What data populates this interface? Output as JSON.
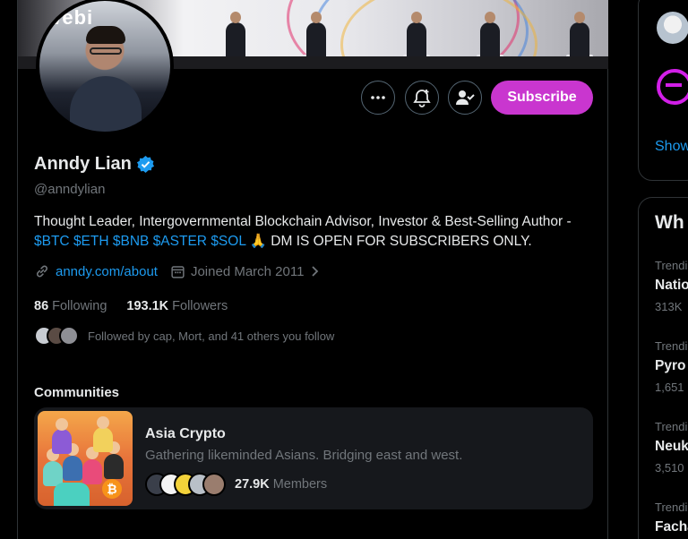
{
  "profile": {
    "name": "Anndy Lian",
    "handle": "@anndylian",
    "bio_text": "Thought Leader, Intergovernmental Blockchain Advisor, Investor & Best-Selling Author - ",
    "bio_tags": [
      "$BTC",
      "$ETH",
      "$BNB",
      "$ASTER",
      "$SOL"
    ],
    "bio_emoji": "🙏",
    "bio_tail": " DM IS OPEN FOR SUBSCRIBERS ONLY.",
    "website": "anndy.com/about",
    "joined": "Joined March 2011",
    "following_count": "86",
    "following_label": "Following",
    "followers_count": "193.1K",
    "followers_label": "Followers",
    "followed_by": "Followed by cap, Mort, and 41 others you follow",
    "avatar_banner_text": "Webi"
  },
  "actions": {
    "more_icon": "more-horizontal-icon",
    "notify_icon": "bell-plus-icon",
    "following_icon": "person-check-icon",
    "subscribe_label": "Subscribe"
  },
  "communities": {
    "title": "Communities",
    "items": [
      {
        "name": "Asia Crypto",
        "description": "Gathering likeminded Asians. Bridging east and west.",
        "members_count": "27.9K",
        "members_label": "Members"
      }
    ]
  },
  "sidebar": {
    "show_more": "Show",
    "section_title": "Wh",
    "trends": [
      {
        "context": "Trendi",
        "name": "Natio",
        "posts": "313K"
      },
      {
        "context": "Trendi",
        "name": "Pyro",
        "posts": "1,651"
      },
      {
        "context": "Trendi",
        "name": "Neuk",
        "posts": "3,510"
      },
      {
        "context": "Trendi",
        "name": "Facha",
        "posts": ""
      }
    ]
  },
  "colors": {
    "accent_link": "#1d9bf0",
    "subscribe_bg": "#c936cf",
    "verified": "#1d9bf0",
    "text_primary": "#e7e9ea",
    "text_secondary": "#71767b",
    "border": "#2f3336"
  }
}
